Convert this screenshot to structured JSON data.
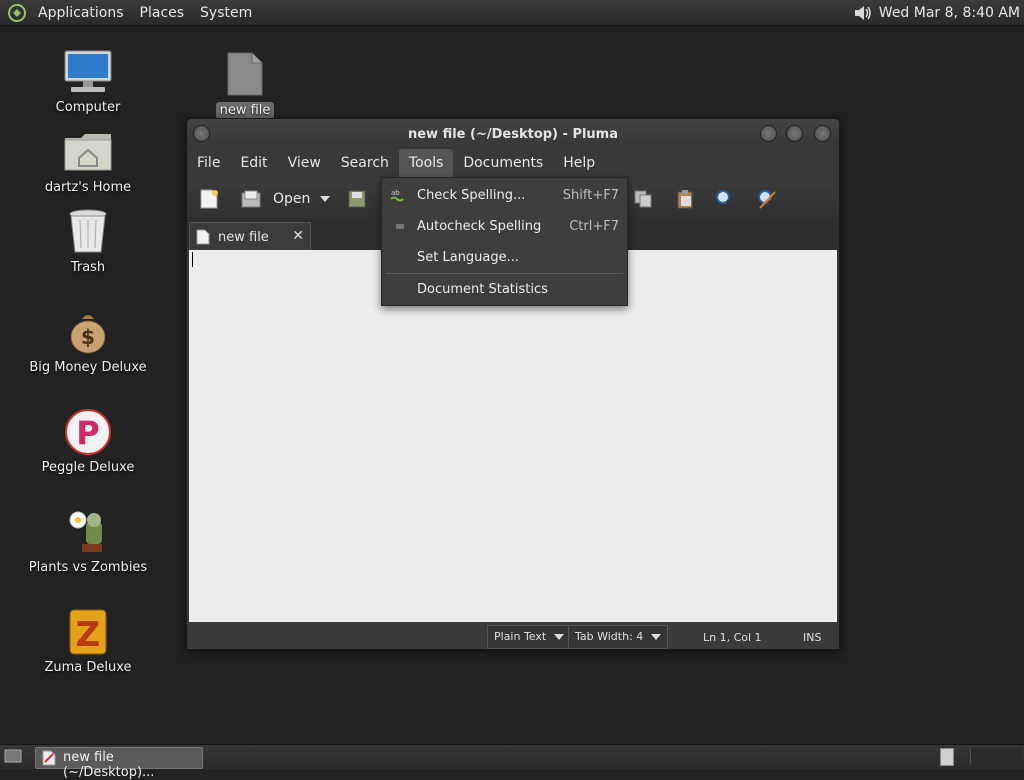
{
  "top_panel": {
    "menus": [
      "Applications",
      "Places",
      "System"
    ],
    "clock": "Wed Mar  8,  8:40 AM"
  },
  "desktop": {
    "icons": [
      {
        "label": "Computer",
        "icon": "computer-icon"
      },
      {
        "label": "dartz's Home",
        "icon": "home-folder-icon"
      },
      {
        "label": "Trash",
        "icon": "trash-icon"
      },
      {
        "label": "Big Money Deluxe",
        "icon": "money-bag-icon"
      },
      {
        "label": "Peggle Deluxe",
        "icon": "peggle-icon"
      },
      {
        "label": "Plants vs Zombies",
        "icon": "plants-icon"
      },
      {
        "label": "Zuma Deluxe",
        "icon": "zuma-icon"
      }
    ],
    "file": {
      "label": "new file",
      "icon": "text-file-icon"
    }
  },
  "window": {
    "title": "new file (~/Desktop) - Pluma",
    "menus": [
      "File",
      "Edit",
      "View",
      "Search",
      "Tools",
      "Documents",
      "Help"
    ],
    "active_menu": "Tools",
    "toolbar": {
      "open_label": "Open"
    },
    "tab": {
      "label": "new file",
      "close": "✕"
    },
    "status": {
      "syntax": "Plain Text",
      "tab_width": "Tab Width:  4",
      "position": "Ln 1, Col 1",
      "mode": "INS"
    }
  },
  "tools_menu": {
    "items": [
      {
        "label": "Check Spelling...",
        "accel": "Shift+F7",
        "icon": "spellcheck-icon"
      },
      {
        "label": "Autocheck Spelling",
        "accel": "Ctrl+F7",
        "icon": "checkbox-icon"
      },
      {
        "label": "Set Language...",
        "accel": "",
        "icon": ""
      },
      {
        "label": "Document Statistics",
        "accel": "",
        "icon": ""
      }
    ]
  },
  "taskbar": {
    "task_label": "new file (~/Desktop)..."
  },
  "colors": {
    "desktop": "#222222",
    "editor_bg": "#ececec",
    "menu_bg": "#3e3e3e"
  }
}
